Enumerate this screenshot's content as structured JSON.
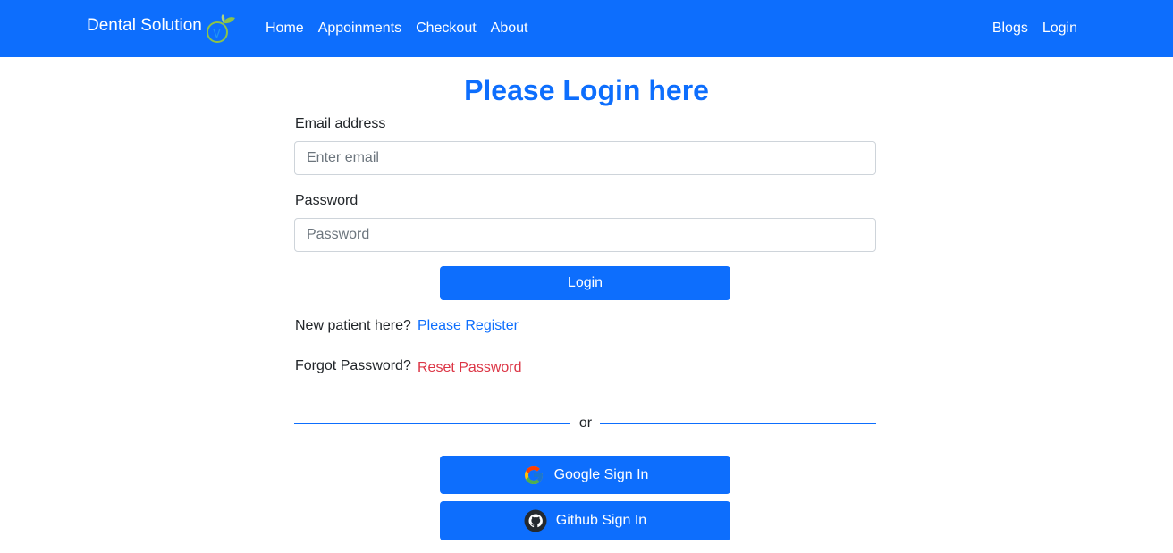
{
  "navbar": {
    "brand": "Dental Solution",
    "logo_icon": "tooth-leaf-logo",
    "left_links": [
      "Home",
      "Appoinments",
      "Checkout",
      "About"
    ],
    "right_links": [
      "Blogs",
      "Login"
    ],
    "color": "#0d6efd"
  },
  "login": {
    "title": "Please Login here",
    "email_label": "Email address",
    "email_placeholder": "Enter email",
    "email_value": "",
    "password_label": "Password",
    "password_placeholder": "Password",
    "password_value": "",
    "login_button": "Login",
    "new_patient_text": "New patient here?",
    "register_link": "Please Register",
    "forgot_text": "Forgot Password?",
    "reset_link": "Reset Password",
    "divider_text": "or",
    "google_button": "Google Sign In",
    "google_icon": "google-icon",
    "github_button": "Github Sign In",
    "github_icon": "github-icon"
  },
  "colors": {
    "primary": "#0d6efd",
    "danger": "#dc3545"
  }
}
